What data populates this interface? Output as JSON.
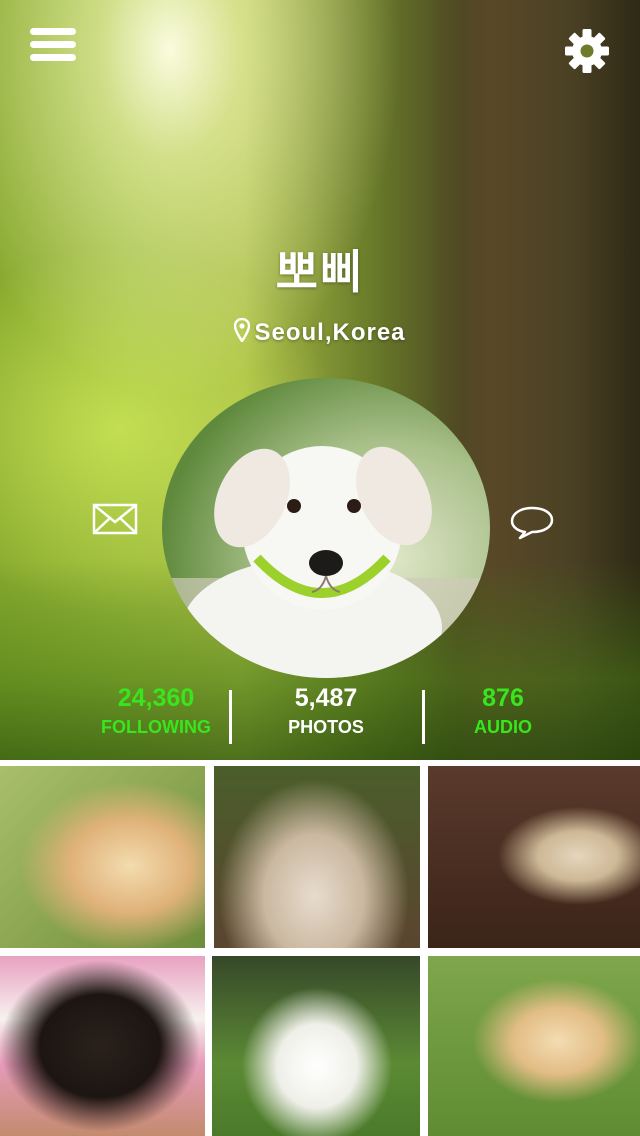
{
  "profile": {
    "name": "뽀삐",
    "location": "Seoul,Korea"
  },
  "stats": [
    {
      "value": "24,360",
      "label": "FOLLOWING",
      "color": "#39e51c"
    },
    {
      "value": "5,487",
      "label": "PHOTOS",
      "color": "#ffffff"
    },
    {
      "value": "876",
      "label": "AUDIO",
      "color": "#39e51c"
    }
  ],
  "icons": {
    "menu": "hamburger-menu-icon",
    "settings": "gear-icon",
    "location": "location-pin-icon",
    "mail": "mail-icon",
    "chat": "chat-bubble-icon"
  },
  "photos": [
    "golden-retriever-puppy-photo",
    "pug-in-blanket-photo",
    "pug-on-floor-photo",
    "dachshund-puppy-photo",
    "white-maltese-photo",
    "golden-puppy-in-bowl-photo"
  ]
}
